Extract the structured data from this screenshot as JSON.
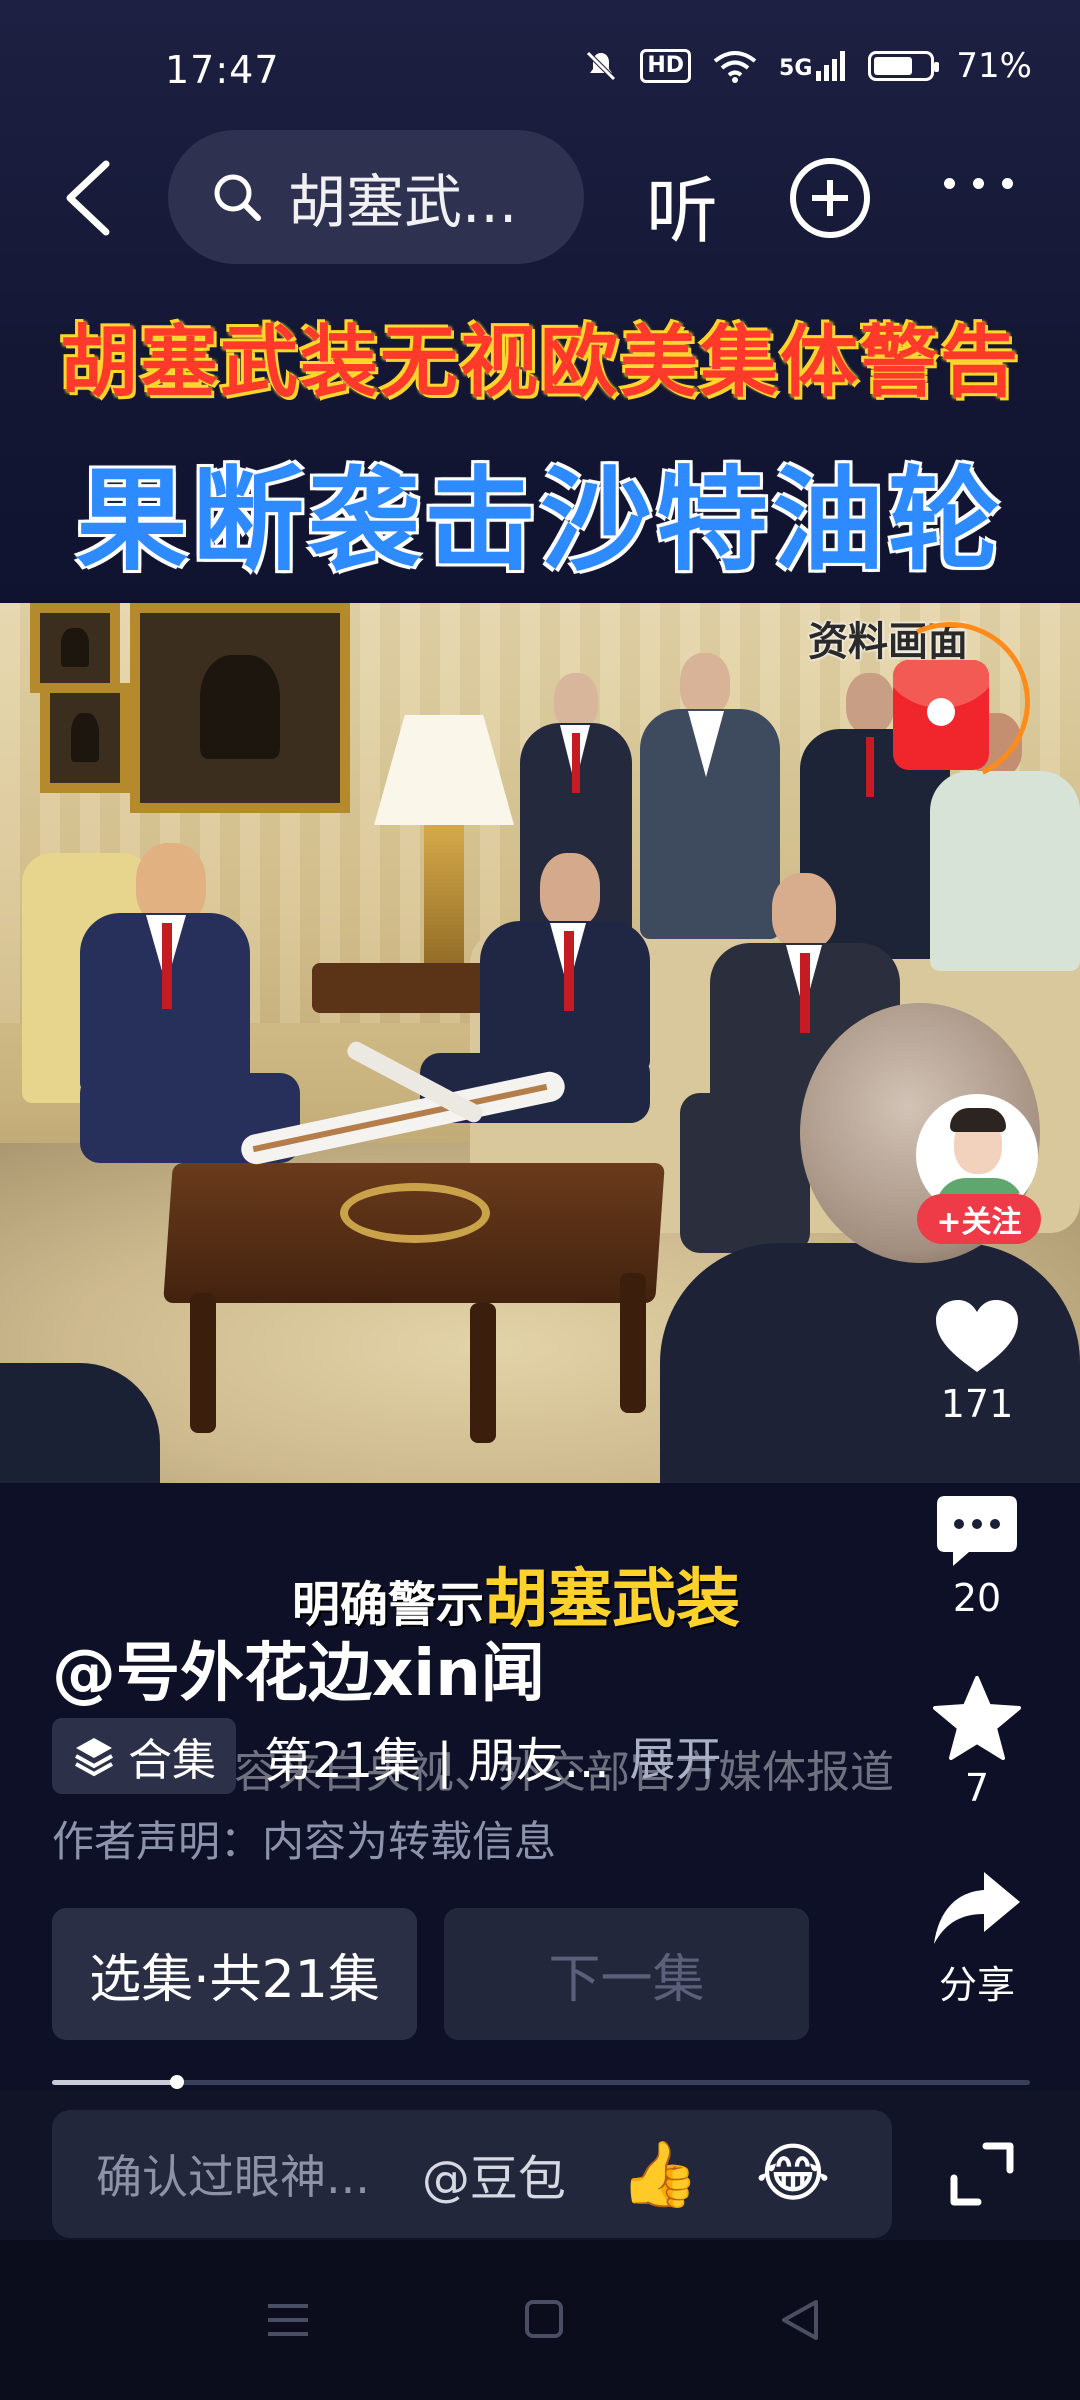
{
  "status_bar": {
    "time": "17:47",
    "network": "5G",
    "hd": "HD",
    "battery": "71%",
    "battery_level": 0.71
  },
  "nav": {
    "search_text": "胡塞武...",
    "listen_label": "听",
    "icons": [
      "back-icon",
      "search-icon",
      "add-icon",
      "more-icon"
    ]
  },
  "video": {
    "headline_1": "胡塞武装无视欧美集体警告",
    "headline_2": "果断袭击沙特油轮",
    "source_tag": "资料画面",
    "caption_prefix": "明确警示",
    "caption_highlight": "胡塞武装"
  },
  "post": {
    "author": "@号外花边xin闻",
    "collection_label": "合集",
    "episode_text": "第21集 | 朋友...",
    "expand_label": "展开",
    "overlay_subtitle": "内容来自央视、外交部官方媒体报道",
    "author_note": "作者声明：内容为转载信息",
    "select_episodes": "选集·共21集",
    "next_episode": "下一集",
    "progress": 0.128
  },
  "rail": {
    "follow_label": "+关注",
    "likes": "171",
    "comments": "20",
    "favorites": "7",
    "share_label": "分享"
  },
  "input_bar": {
    "placeholder": "确认过眼神...",
    "mention": "@豆包",
    "emoji_1": "👍",
    "emoji_2": "😂"
  },
  "colors": {
    "headline_red": "#ff3a2a",
    "headline_blue": "#2d8bff",
    "caption_yellow": "#ffd12b",
    "follow_red": "#ef3b48",
    "background": "#0d1026"
  }
}
